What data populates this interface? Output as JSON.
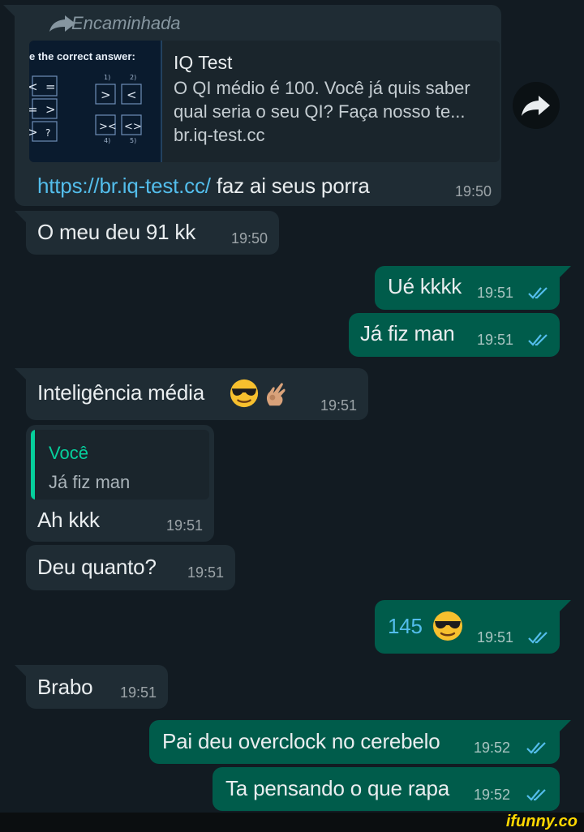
{
  "colors": {
    "background": "#121b22",
    "incoming_bubble": "#1f2c34",
    "outgoing_bubble": "#005c4b",
    "read_ticks": "#53bdeb",
    "link": "#53bdeb",
    "quote_accent": "#06cf9c"
  },
  "forwarded_message": {
    "forwarded_label": "Encaminhada",
    "preview": {
      "thumbnail_caption": "e the correct answer:",
      "title": "IQ Test",
      "description": "O QI médio é 100. Você já quis saber qual seria o seu QI? Faça nosso te...",
      "domain": "br.iq-test.cc"
    },
    "link_text": "https://br.iq-test.cc/",
    "text": " faz ai seus porra",
    "time": "19:50",
    "share_icon": "share-forward-icon"
  },
  "messages": [
    {
      "id": "m2",
      "direction": "in",
      "text": "O meu deu 91 kk",
      "time": "19:50"
    },
    {
      "id": "m3",
      "direction": "out",
      "text": "Ué kkkk",
      "time": "19:51",
      "status": "read"
    },
    {
      "id": "m4",
      "direction": "out",
      "text": "Já fiz man",
      "time": "19:51",
      "status": "read"
    },
    {
      "id": "m5",
      "direction": "in",
      "text": "Inteligência média",
      "emoji": [
        "smiling-face-with-sunglasses",
        "ok-hand"
      ],
      "time": "19:51"
    },
    {
      "id": "m6",
      "direction": "in",
      "quote_author": "Você",
      "quote_text": "Já fiz man",
      "text": "Ah kkk",
      "time": "19:51"
    },
    {
      "id": "m7",
      "direction": "in",
      "text": "Deu quanto?",
      "time": "19:51"
    },
    {
      "id": "m8",
      "direction": "out",
      "text": "145",
      "emoji": [
        "smiling-face-with-sunglasses"
      ],
      "time": "19:51",
      "status": "read"
    },
    {
      "id": "m9",
      "direction": "in",
      "text": "Brabo",
      "time": "19:51"
    },
    {
      "id": "m10",
      "direction": "out",
      "text": "Pai deu overclock no cerebelo",
      "time": "19:52",
      "status": "read"
    },
    {
      "id": "m11",
      "direction": "out",
      "text": "Ta pensando o que rapa",
      "time": "19:52",
      "status": "read"
    }
  ],
  "watermark": "ifunny.co"
}
